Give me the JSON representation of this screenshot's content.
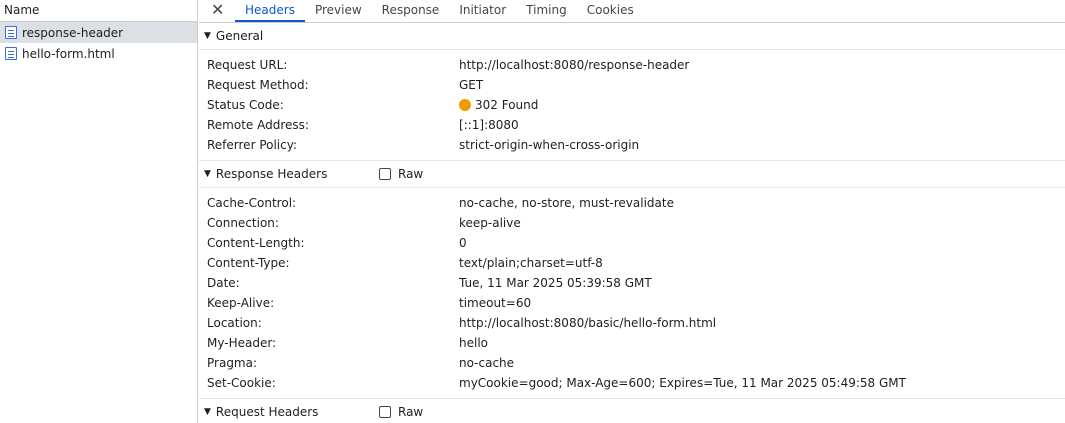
{
  "left_panel": {
    "header": "Name",
    "requests": [
      {
        "name": "response-header",
        "selected": true
      },
      {
        "name": "hello-form.html",
        "selected": false
      }
    ]
  },
  "tabs": {
    "close_icon": "close-icon",
    "items": [
      "Headers",
      "Preview",
      "Response",
      "Initiator",
      "Timing",
      "Cookies"
    ],
    "active": "Headers",
    "accent_color": "#0b57d0"
  },
  "general": {
    "title": "General",
    "rows": [
      {
        "key": "Request URL:",
        "value": "http://localhost:8080/response-header"
      },
      {
        "key": "Request Method:",
        "value": "GET"
      },
      {
        "key": "Status Code:",
        "value": "302 Found",
        "status_color": "#f29900"
      },
      {
        "key": "Remote Address:",
        "value": "[::1]:8080"
      },
      {
        "key": "Referrer Policy:",
        "value": "strict-origin-when-cross-origin"
      }
    ]
  },
  "response_headers": {
    "title": "Response Headers",
    "raw_label": "Raw",
    "rows": [
      {
        "key": "Cache-Control:",
        "value": "no-cache, no-store, must-revalidate"
      },
      {
        "key": "Connection:",
        "value": "keep-alive"
      },
      {
        "key": "Content-Length:",
        "value": "0"
      },
      {
        "key": "Content-Type:",
        "value": "text/plain;charset=utf-8"
      },
      {
        "key": "Date:",
        "value": "Tue, 11 Mar 2025 05:39:58 GMT"
      },
      {
        "key": "Keep-Alive:",
        "value": "timeout=60"
      },
      {
        "key": "Location:",
        "value": "http://localhost:8080/basic/hello-form.html"
      },
      {
        "key": "My-Header:",
        "value": "hello"
      },
      {
        "key": "Pragma:",
        "value": "no-cache"
      },
      {
        "key": "Set-Cookie:",
        "value": "myCookie=good; Max-Age=600; Expires=Tue, 11 Mar 2025 05:49:58 GMT"
      }
    ]
  },
  "request_headers": {
    "title": "Request Headers",
    "raw_label": "Raw"
  }
}
